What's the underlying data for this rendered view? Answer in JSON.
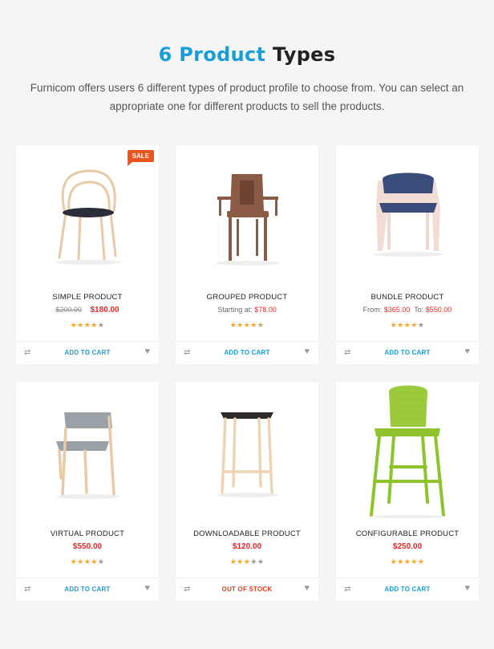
{
  "header": {
    "title_accent": "6 Product",
    "title_rest": "Types",
    "description": "Furnicom offers users 6 different types of product profile to choose from. You can select an appropriate one for different products to sell the products."
  },
  "icons": {
    "compare": "compare-icon",
    "wishlist": "heart-icon",
    "rating": "star-icon"
  },
  "colors": {
    "accent": "#1a9ed8",
    "price": "#e02a2a",
    "sale": "#f0541e",
    "star": "#f5a623"
  },
  "products": [
    {
      "name": "SIMPLE PRODUCT",
      "sale_badge": "SALE",
      "old_price": "$200.00",
      "price": "$180.00",
      "rating": 4,
      "action": "ADD TO CART"
    },
    {
      "name": "GROUPED PRODUCT",
      "price_prefix": "Starting at:",
      "price": "$78.00",
      "rating": 4.5,
      "action": "ADD TO CART"
    },
    {
      "name": "BUNDLE PRODUCT",
      "price_from_label": "From:",
      "price_from": "$365.00",
      "price_to_label": "To:",
      "price_to": "$550.00",
      "rating": 4,
      "action": "ADD TO CART"
    },
    {
      "name": "VIRTUAL PRODUCT",
      "price": "$550.00",
      "rating": 4,
      "action": "ADD TO CART"
    },
    {
      "name": "DOWNLOADABLE PRODUCT",
      "price": "$120.00",
      "rating": 3,
      "action": "OUT OF STOCK"
    },
    {
      "name": "CONFIGURABLE PRODUCT",
      "price": "$250.00",
      "rating": 5,
      "action": "ADD TO CART"
    }
  ]
}
